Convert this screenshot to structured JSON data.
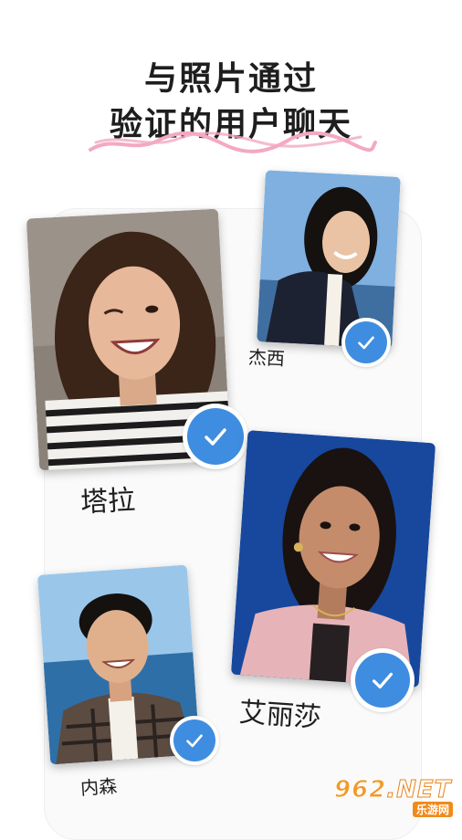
{
  "headline": {
    "line1": "与照片通过",
    "line2": "验证的用户聊天"
  },
  "profiles": [
    {
      "name": "塔拉",
      "verified": true
    },
    {
      "name": "杰西",
      "verified": true
    },
    {
      "name": "艾丽莎",
      "verified": true
    },
    {
      "name": "内森",
      "verified": true
    }
  ],
  "watermark": {
    "main_prefix": "962",
    "main_suffix": ".NET",
    "sub": "乐游网"
  },
  "colors": {
    "verified_badge": "#3f8de0",
    "squiggle": "#f3a9c2"
  },
  "icons": [
    "checkmark-icon",
    "squiggle-underline"
  ]
}
